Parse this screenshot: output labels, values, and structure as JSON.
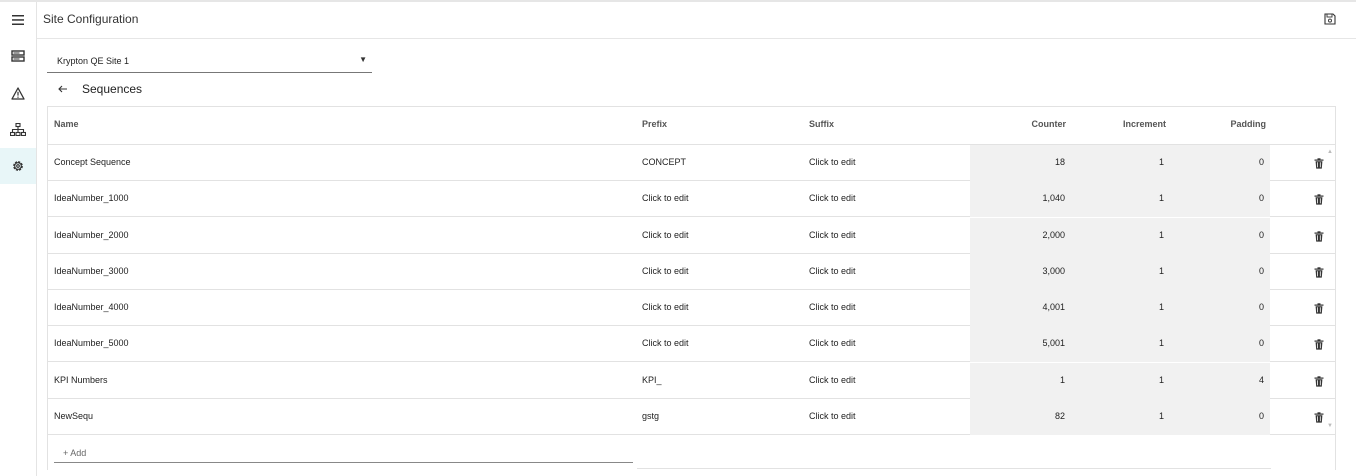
{
  "header": {
    "title": "Site Configuration"
  },
  "site_selector": {
    "value": "Krypton QE Site 1"
  },
  "section": {
    "title": "Sequences"
  },
  "table": {
    "columns": {
      "name": "Name",
      "prefix": "Prefix",
      "suffix": "Suffix",
      "counter": "Counter",
      "increment": "Increment",
      "padding": "Padding"
    },
    "rows": [
      {
        "name": "Concept Sequence",
        "prefix": "CONCEPT",
        "suffix": "Click to edit",
        "counter": "18",
        "increment": "1",
        "padding": "0"
      },
      {
        "name": "IdeaNumber_1000",
        "prefix": "Click to edit",
        "suffix": "Click to edit",
        "counter": "1,040",
        "increment": "1",
        "padding": "0"
      },
      {
        "name": "IdeaNumber_2000",
        "prefix": "Click to edit",
        "suffix": "Click to edit",
        "counter": "2,000",
        "increment": "1",
        "padding": "0"
      },
      {
        "name": "IdeaNumber_3000",
        "prefix": "Click to edit",
        "suffix": "Click to edit",
        "counter": "3,000",
        "increment": "1",
        "padding": "0"
      },
      {
        "name": "IdeaNumber_4000",
        "prefix": "Click to edit",
        "suffix": "Click to edit",
        "counter": "4,001",
        "increment": "1",
        "padding": "0"
      },
      {
        "name": "IdeaNumber_5000",
        "prefix": "Click to edit",
        "suffix": "Click to edit",
        "counter": "5,001",
        "increment": "1",
        "padding": "0"
      },
      {
        "name": "KPI Numbers",
        "prefix": "KPI_",
        "suffix": "Click to edit",
        "counter": "1",
        "increment": "1",
        "padding": "4"
      },
      {
        "name": "NewSequ",
        "prefix": "gstg",
        "suffix": "Click to edit",
        "counter": "82",
        "increment": "1",
        "padding": "0"
      }
    ],
    "add_label": "+ Add"
  },
  "sidebar": {
    "items": [
      {
        "icon": "menu-icon"
      },
      {
        "icon": "server-icon"
      },
      {
        "icon": "warning-icon"
      },
      {
        "icon": "sitemap-icon"
      },
      {
        "icon": "gear-icon",
        "active": true
      }
    ]
  },
  "colors": {
    "active_nav_bg": "#e8f6f8",
    "numeric_cell_bg": "#f1f1f1"
  }
}
